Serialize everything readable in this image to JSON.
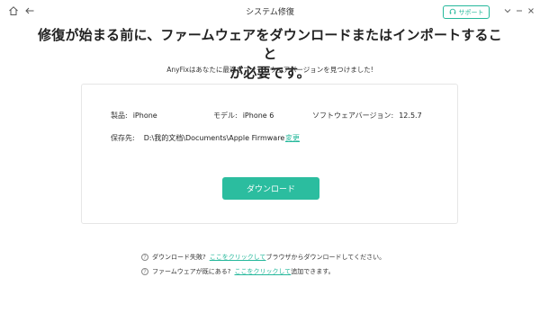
{
  "window": {
    "title": "システム修復",
    "support_label": "サポート"
  },
  "icons": [
    "home-icon",
    "back-arrow-icon",
    "headset-icon",
    "chevron-down-icon",
    "minimize-icon",
    "close-icon",
    "question-circle-icon"
  ],
  "colors": {
    "accent": "#2bbd9f",
    "link": "#25b89b"
  },
  "main": {
    "heading_line1": "修復が始まる前に、ファームウェアをダウンロードまたはインポートすること",
    "heading_line2": "が必要です。",
    "subtitle": "AnyFixはあなたに最適なファームウェアバージョンを見つけました!"
  },
  "firmware": {
    "product_label": "製品:",
    "product_value": "iPhone",
    "model_label": "モデル:",
    "model_value": "iPhone 6",
    "version_label": "ソフトウェアバージョン:",
    "version_value": "12.5.7",
    "save_label": "保存先:",
    "save_path": "D:\\我的文档\\Documents\\Apple Firmware",
    "change_link": "変更",
    "download_button": "ダウンロード"
  },
  "help": {
    "line1_prefix": "ダウンロード失敗?",
    "line1_link": "ここをクリックして",
    "line1_suffix": "ブラウザからダウンロードしてください。",
    "line2_prefix": "ファームウェアが既にある?",
    "line2_link": "ここをクリックして",
    "line2_suffix": "追加できます。"
  }
}
